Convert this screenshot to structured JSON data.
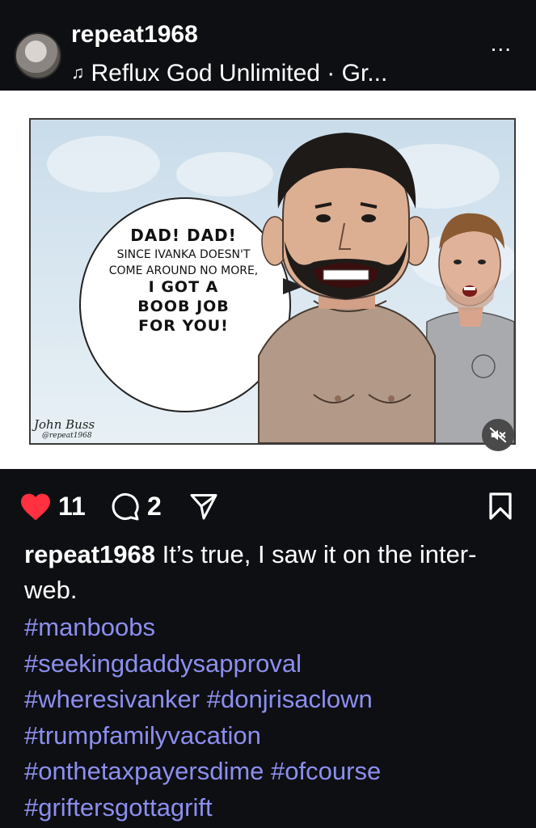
{
  "header": {
    "username": "repeat1968",
    "audio_note_icon": "music-note-icon",
    "audio_label": "Reflux God Unlimited · Gr...",
    "more_label": "..."
  },
  "media": {
    "bubble_line1": "DAD! DAD!",
    "bubble_line2": "SINCE IVANKA DOESN'T",
    "bubble_line3": "COME AROUND NO MORE,",
    "bubble_line4": "I GOT A",
    "bubble_line5": "BOOB JOB",
    "bubble_line6": "FOR YOU!",
    "signature_name": "John Buss",
    "signature_handle": "@repeat1968",
    "mute_icon": "muted-speaker-icon"
  },
  "actions": {
    "like_count": "11",
    "comment_count": "2",
    "like_color": "#ff3040"
  },
  "caption": {
    "username": "repeat1968",
    "text": "It’s true, I saw it on the inter-web.",
    "hashtags": [
      "#manboobs",
      "#seekingdaddysapproval",
      "#wheresivanker",
      "#donjrisaclown",
      "#trumpfamilyvacation",
      "#onthetaxpayersdime",
      "#ofcourse",
      "#griftersgottagrift"
    ],
    "hashtag_color": "#8c8fef"
  }
}
